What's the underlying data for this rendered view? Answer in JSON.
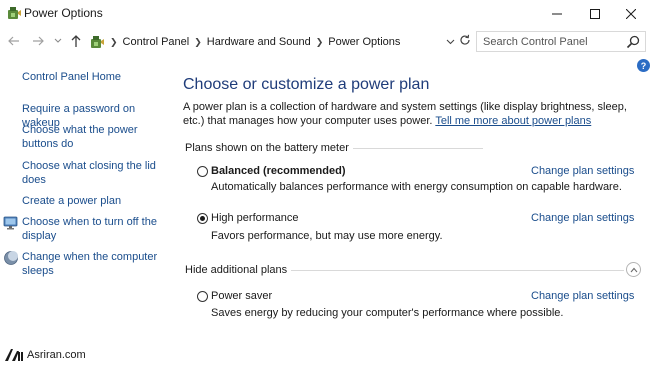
{
  "window": {
    "title": "Power Options",
    "minimize_glyph": "—",
    "maximize_glyph": "☐",
    "close_glyph": "✕"
  },
  "address_bar": {
    "breadcrumbs": [
      "Control Panel",
      "Hardware and Sound",
      "Power Options"
    ],
    "search_placeholder": "Search Control Panel"
  },
  "help_glyph": "?",
  "sidebar": {
    "home": "Control Panel Home",
    "items": [
      {
        "label_lines": [
          "Require a password on wakeup"
        ],
        "icon": null
      },
      {
        "label_lines": [
          "Choose what the power",
          "buttons do"
        ],
        "icon": null
      },
      {
        "label_lines": [
          "Choose what closing the lid",
          "does"
        ],
        "icon": null
      },
      {
        "label_lines": [
          "Create a power plan"
        ],
        "icon": null
      },
      {
        "label_lines": [
          "Choose when to turn off the",
          "display"
        ],
        "icon": "monitor-icon"
      },
      {
        "label_lines": [
          "Change when the computer",
          "sleeps"
        ],
        "icon": "moon-icon"
      }
    ]
  },
  "main": {
    "heading": "Choose or customize a power plan",
    "intro_text": "A power plan is a collection of hardware and system settings (like display brightness, sleep, etc.) that manages how your computer uses power.",
    "intro_link": "Tell me more about power plans",
    "group_battery": "Plans shown on the battery meter",
    "group_hidden": "Hide additional plans",
    "plans": [
      {
        "name": "Balanced (recommended)",
        "bold": true,
        "selected": false,
        "description": "Automatically balances performance with energy consumption on capable hardware.",
        "link": "Change plan settings"
      },
      {
        "name": "High performance",
        "bold": false,
        "selected": true,
        "description": "Favors performance, but may use more energy.",
        "link": "Change plan settings"
      },
      {
        "name": "Power saver",
        "bold": false,
        "selected": false,
        "description": "Saves energy by reducing your computer's performance where possible.",
        "link": "Change plan settings"
      }
    ]
  },
  "watermark": {
    "text": "Asriran.com"
  },
  "colors": {
    "link": "#1a4d8c",
    "heading": "#1f3c7a",
    "help_badge": "#2b6cc4"
  }
}
